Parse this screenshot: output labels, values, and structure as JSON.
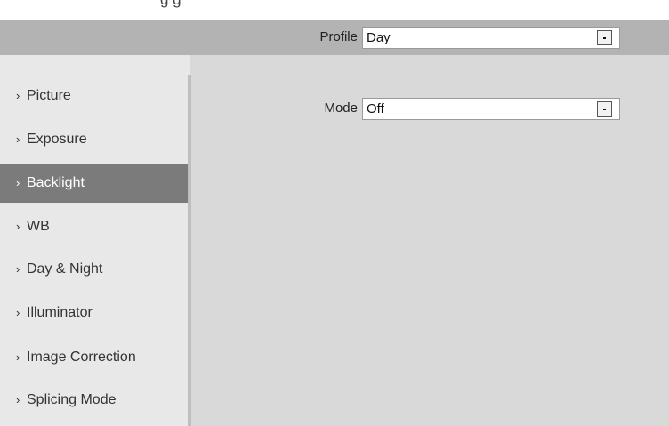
{
  "top_strip": {
    "text": "g      g"
  },
  "profile": {
    "label": "Profile",
    "value": "Day"
  },
  "sidebar": {
    "items": [
      {
        "label": "Picture",
        "active": false
      },
      {
        "label": "Exposure",
        "active": false
      },
      {
        "label": "Backlight",
        "active": true
      },
      {
        "label": "WB",
        "active": false
      },
      {
        "label": "Day & Night",
        "active": false
      },
      {
        "label": "Illuminator",
        "active": false
      },
      {
        "label": "Image Correction",
        "active": false
      },
      {
        "label": "Splicing Mode",
        "active": false
      }
    ]
  },
  "backlight": {
    "mode_label": "Mode",
    "mode_value": "Off"
  },
  "icons": {
    "bullet": "▸-bullet",
    "dropdown": "chevron-down-icon"
  },
  "colors": {
    "active_item": "#7b7b7b",
    "profile_bar": "#b3b3b3",
    "background": "#d9d9d9"
  }
}
